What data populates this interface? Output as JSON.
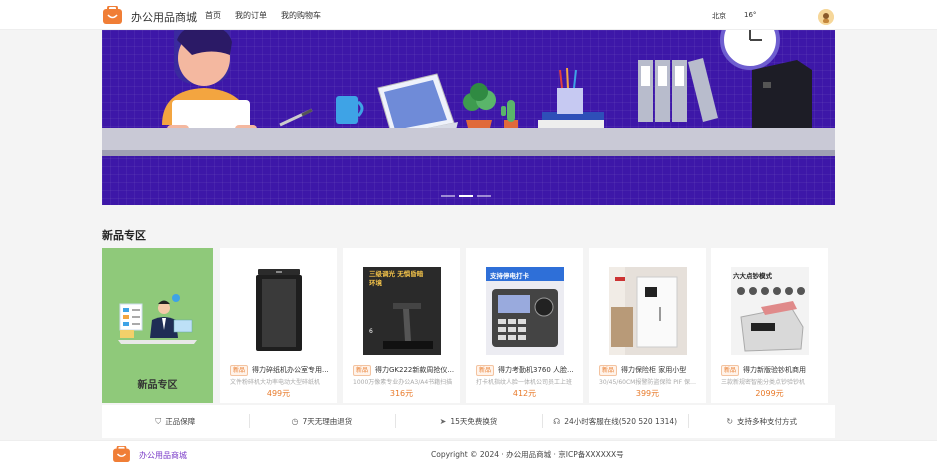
{
  "header": {
    "brand": "办公用品商城",
    "nav": [
      "首页",
      "我的订单",
      "我的购物车"
    ],
    "city": "北京",
    "temperature": "16°"
  },
  "banner": {
    "slide_count": 3,
    "active_slide": 2
  },
  "section": {
    "title": "新品专区",
    "feature_label": "新品专区"
  },
  "products": [
    {
      "tag": "新品",
      "name": "得力碎纸机办公室专用...",
      "desc": "文件粉碎机大功率电动大型碎纸机",
      "price": "499元",
      "img_text": ""
    },
    {
      "tag": "新品",
      "name": "得力GK222新款周抢仪...",
      "desc": "1000万像素专业办公A3/A4书籍扫描",
      "price": "316元",
      "img_text": "三级调光 无惧昏暗环境"
    },
    {
      "tag": "新品",
      "name": "得力考勤机3760 人脸...",
      "desc": "打卡机指纹人脸一体机公司员工上班",
      "price": "412元",
      "img_text": "支持停电打卡"
    },
    {
      "tag": "新品",
      "name": "得力保险柜 家用小型",
      "desc": "30/45/60CM报警防盗保险 PIF 保险柜",
      "price": "399元",
      "img_text": ""
    },
    {
      "tag": "新品",
      "name": "得力新版验钞机商用",
      "desc": "三款新规密智能分类点钞验钞机",
      "price": "2099元",
      "img_text": "六大点钞模式"
    }
  ],
  "services": [
    {
      "icon": "shield-icon",
      "glyph": "⛉",
      "label": "正品保障"
    },
    {
      "icon": "clock-icon",
      "glyph": "◷",
      "label": "7天无理由退货"
    },
    {
      "icon": "send-icon",
      "glyph": "➤",
      "label": "15天免费换货"
    },
    {
      "icon": "headset-icon",
      "glyph": "☊",
      "label": "24小时客服在线(520 520 1314)"
    },
    {
      "icon": "refresh-icon",
      "glyph": "↻",
      "label": "支持多种支付方式"
    }
  ],
  "footer": {
    "brand": "办公用品商城",
    "copyright": "Copyright © 2024 · 办公用品商城 · 京ICP备XXXXXX号"
  },
  "colors": {
    "banner": "#3d17a8",
    "accent": "#e87a2a",
    "feature": "#8fc97a",
    "brand": "#f07e36"
  }
}
